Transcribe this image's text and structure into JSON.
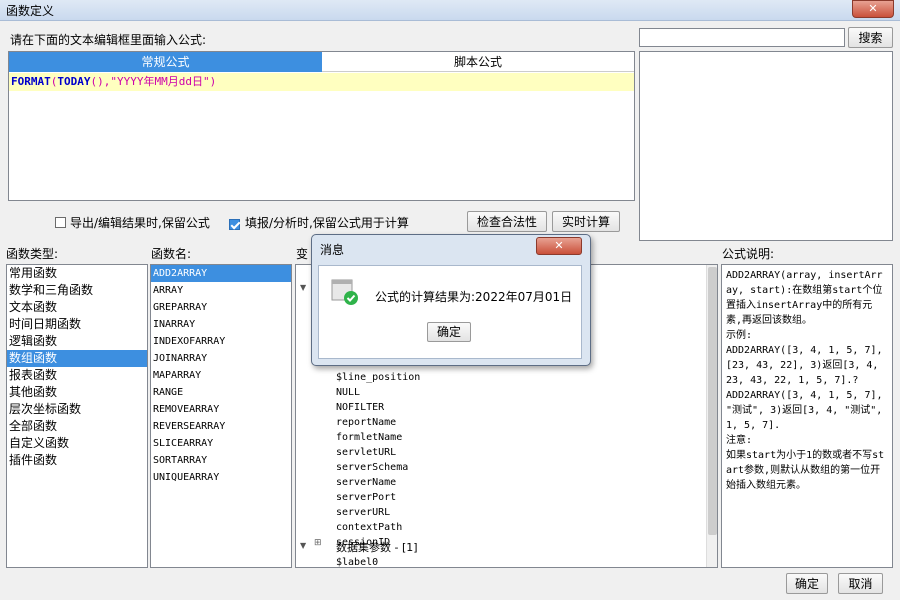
{
  "window": {
    "title": "函数定义",
    "close_label": "✕"
  },
  "editor": {
    "prompt": "请在下面的文本编辑框里面输入公式:",
    "tabs": [
      {
        "label": "常规公式"
      },
      {
        "label": "脚本公式"
      }
    ],
    "formula": {
      "func": "FORMAT",
      "lp": "(",
      "func2": "TODAY",
      "parens": "()",
      "comma": ",",
      "str": "\"YYYY年MM月dd日\"",
      "rp": ")"
    }
  },
  "search": {
    "value": "",
    "button": "搜索"
  },
  "options": {
    "keep_export": {
      "label": "导出/编辑结果时,保留公式",
      "checked": false
    },
    "keep_fill": {
      "label": "填报/分析时,保留公式用于计算",
      "checked": true
    },
    "check_button": "检查合法性",
    "realtime_button": "实时计算"
  },
  "categories": {
    "header": "函数类型:",
    "items": [
      "常用函数",
      "数学和三角函数",
      "文本函数",
      "时间日期函数",
      "逻辑函数",
      "数组函数",
      "报表函数",
      "其他函数",
      "层次坐标函数",
      "全部函数",
      "自定义函数",
      "插件函数"
    ],
    "selected": 5
  },
  "functions": {
    "header": "函数名:",
    "items": [
      "ADD2ARRAY",
      "ARRAY",
      "GREPARRAY",
      "INARRAY",
      "INDEXOFARRAY",
      "JOINARRAY",
      "MAPARRAY",
      "RANGE",
      "REMOVEARRAY",
      "REVERSEARRAY",
      "SLICEARRAY",
      "SORTARRAY",
      "UNIQUEARRAY"
    ],
    "selected": 0
  },
  "variables": {
    "header": "变",
    "items": [
      "$line_position",
      "NULL",
      "NOFILTER",
      "reportName",
      "formletName",
      "servletURL",
      "serverSchema",
      "serverName",
      "serverPort",
      "serverURL",
      "contextPath",
      "sessionID"
    ],
    "dataset_node": "数据集参数 - [1]",
    "dataset_child": "$label0"
  },
  "description": {
    "header": "公式说明:",
    "text": "ADD2ARRAY(array, insertArray, start):在数组第start个位置插入insertArray中的所有元素,再返回该数组。\n示例:\nADD2ARRAY([3, 4, 1, 5, 7], [23, 43, 22], 3)返回[3, 4, 23, 43, 22, 1, 5, 7].?\nADD2ARRAY([3, 4, 1, 5, 7], \"测试\", 3)返回[3, 4, \"测试\", 1, 5, 7].\n注意:\n如果start为小于1的数或者不写start参数,则默认从数组的第一位开始插入数组元素。"
  },
  "dialog": {
    "title": "消息",
    "close_label": "✕",
    "message": "公式的计算结果为:2022年07月01日",
    "ok_button": "确定"
  },
  "footer": {
    "ok_button": "确定",
    "cancel_button": "取消"
  },
  "colors": {
    "accent": "#3d8fe0",
    "formula_bg": "#ffffc0",
    "func_color": "#0000cc",
    "string_color": "#cc00aa"
  }
}
